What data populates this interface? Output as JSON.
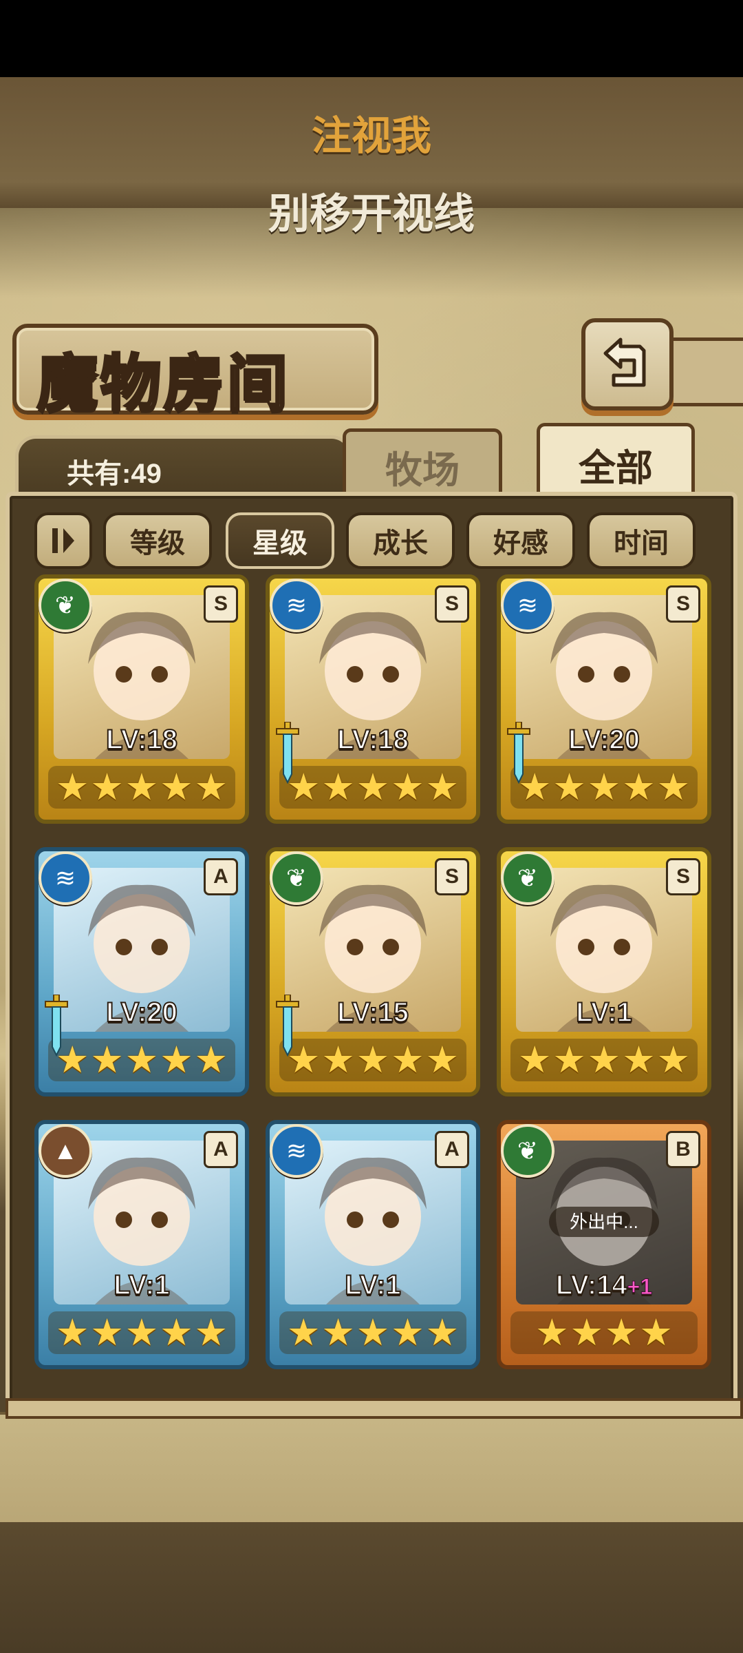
{
  "top_banner": {
    "line1": "注视我",
    "line2": "别移开视线"
  },
  "header": {
    "title": "魔物房间"
  },
  "back_button": {
    "icon": "back-arrow-icon"
  },
  "collection": {
    "count_label": "共有:49"
  },
  "tabs": [
    {
      "label": "牧场",
      "active": false
    },
    {
      "label": "全部",
      "active": true
    }
  ],
  "sort_buttons": [
    {
      "label": "等级",
      "active": false
    },
    {
      "label": "星级",
      "active": true
    },
    {
      "label": "成长",
      "active": false
    },
    {
      "label": "好感",
      "active": false
    },
    {
      "label": "时间",
      "active": false
    }
  ],
  "cards": [
    {
      "element": "leaf",
      "rank": "S",
      "level": "LV:18",
      "bonus": "",
      "stars": 5,
      "frame": "gold",
      "weapon": false,
      "away": ""
    },
    {
      "element": "water",
      "rank": "S",
      "level": "LV:18",
      "bonus": "",
      "stars": 5,
      "frame": "gold",
      "weapon": true,
      "away": ""
    },
    {
      "element": "water",
      "rank": "S",
      "level": "LV:20",
      "bonus": "",
      "stars": 5,
      "frame": "gold",
      "weapon": true,
      "away": ""
    },
    {
      "element": "water",
      "rank": "A",
      "level": "LV:20",
      "bonus": "",
      "stars": 5,
      "frame": "blue",
      "weapon": true,
      "away": ""
    },
    {
      "element": "leaf",
      "rank": "S",
      "level": "LV:15",
      "bonus": "",
      "stars": 5,
      "frame": "gold",
      "weapon": true,
      "away": ""
    },
    {
      "element": "leaf",
      "rank": "S",
      "level": "LV:1",
      "bonus": "",
      "stars": 5,
      "frame": "gold",
      "weapon": false,
      "away": ""
    },
    {
      "element": "earth",
      "rank": "A",
      "level": "LV:1",
      "bonus": "",
      "stars": 5,
      "frame": "blue",
      "weapon": false,
      "away": ""
    },
    {
      "element": "water",
      "rank": "A",
      "level": "LV:1",
      "bonus": "",
      "stars": 5,
      "frame": "blue",
      "weapon": false,
      "away": ""
    },
    {
      "element": "leaf",
      "rank": "B",
      "level": "LV:14",
      "bonus": "+1",
      "stars": 4,
      "frame": "orange",
      "weapon": false,
      "away": "外出中..."
    }
  ]
}
